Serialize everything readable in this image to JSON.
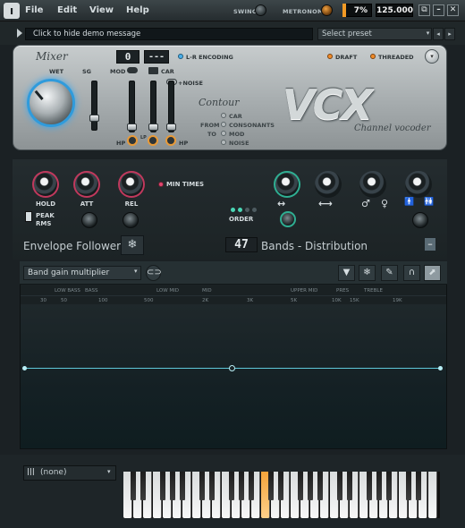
{
  "menu": {
    "file": "File",
    "edit": "Edit",
    "view": "View",
    "help": "Help"
  },
  "transport": {
    "swing": "SWING",
    "metronome": "METRONOME",
    "cpu": "7%",
    "cpu_fill_percent": 7,
    "tempo": "125.000"
  },
  "window_buttons": {
    "tile": "⧉",
    "minimize": "–",
    "maximize": "□",
    "close": "✕"
  },
  "header": {
    "demo_message": "Click to hide demo message",
    "preset_placeholder": "Select preset",
    "prev": "◂",
    "next": "▸",
    "more": "▸"
  },
  "mixer": {
    "title": "Mixer",
    "wet": "WET",
    "sg": "SG",
    "mod": "MOD",
    "car": "CAR",
    "noise": "+NOISE",
    "lr_encoding": "L-R ENCODING",
    "lcd_left": "0",
    "lcd_right": "---",
    "hp1": "HP",
    "lp": "LP",
    "hp2": "HP",
    "draft": "DRAFT",
    "threaded": "THREADED"
  },
  "contour": {
    "title": "Contour",
    "from": "FROM",
    "to": "TO",
    "options": [
      "CAR",
      "CONSONANTS",
      "MOD",
      "NOISE"
    ]
  },
  "logo": {
    "name": "VCX",
    "subtitle": "Channel vocoder"
  },
  "envelope": {
    "hold": "HOLD",
    "att": "ATT",
    "rel": "REL",
    "min_times": "MIN TIMES",
    "peak": "PEAK",
    "rms": "RMS",
    "title": "Envelope Follower",
    "order": "ORDER",
    "stereo_icon": "↔",
    "width_icon": "⟷",
    "male_icon": "♂",
    "female_icon": "♀",
    "person_icon": "🚹",
    "persons_icon": "🚻",
    "snow_icon": "❄"
  },
  "bands": {
    "count": "47",
    "label": "Bands - Distribution",
    "minus": "–"
  },
  "editor": {
    "dropdown": "Band gain multiplier",
    "row1": [
      "LOW BASS",
      "BASS",
      "LOW MID",
      "MID",
      "UPPER MID",
      "PRES",
      "TREBLE"
    ],
    "row2": [
      "30",
      "50",
      "100",
      "500",
      "2K",
      "3K",
      "5K",
      "10K",
      "15K",
      "19K"
    ],
    "tools": {
      "down": "▼",
      "snow": "❄",
      "pen": "✎",
      "arc": "∩",
      "pointer": "⬈"
    }
  },
  "keyboard": {
    "instrument": "(none)",
    "instrument_icon": "|||"
  }
}
